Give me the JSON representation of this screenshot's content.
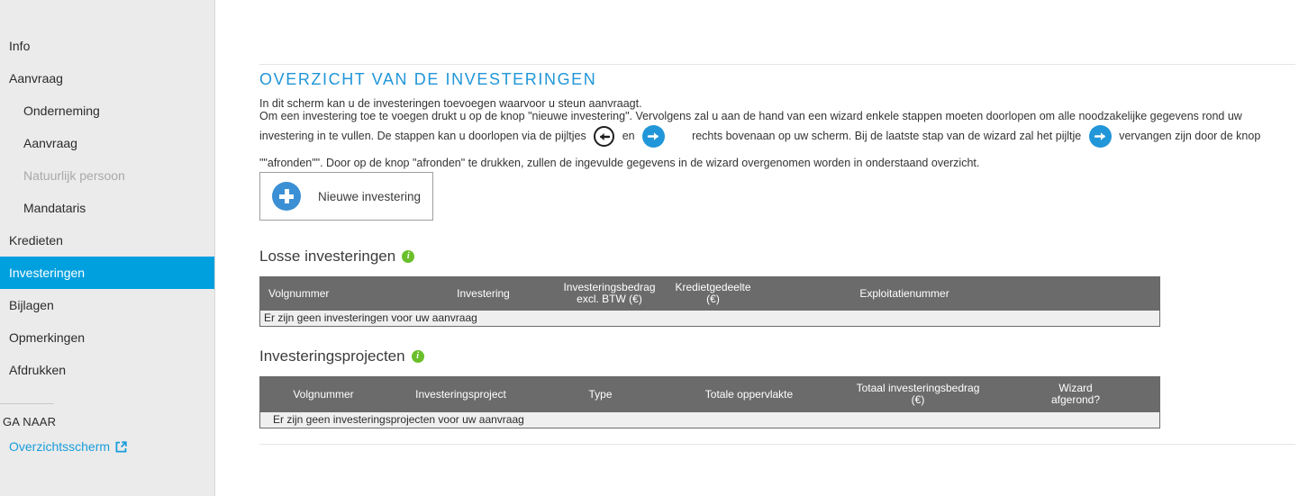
{
  "sidebar": {
    "items": [
      {
        "label": "Info",
        "level": 1,
        "state": "normal"
      },
      {
        "label": "Aanvraag",
        "level": 1,
        "state": "normal"
      },
      {
        "label": "Onderneming",
        "level": 2,
        "state": "normal"
      },
      {
        "label": "Aanvraag",
        "level": 2,
        "state": "normal"
      },
      {
        "label": "Natuurlijk persoon",
        "level": 2,
        "state": "disabled"
      },
      {
        "label": "Mandataris",
        "level": 2,
        "state": "normal"
      },
      {
        "label": "Kredieten",
        "level": 1,
        "state": "normal"
      },
      {
        "label": "Investeringen",
        "level": 1,
        "state": "active"
      },
      {
        "label": "Bijlagen",
        "level": 1,
        "state": "normal"
      },
      {
        "label": "Opmerkingen",
        "level": 1,
        "state": "normal"
      },
      {
        "label": "Afdrukken",
        "level": 1,
        "state": "normal"
      }
    ],
    "goto_label": "GA NAAR",
    "goto_link": "Overzichtsscherm",
    "active_color": "#00a0df",
    "link_color": "#1a9ddb"
  },
  "top_actions": {
    "save": "save-icon",
    "undo": "undo-icon"
  },
  "page": {
    "title": "OVERZICHT VAN DE INVESTERINGEN",
    "title_color": "#2196d8",
    "intro_line1": "In dit scherm kan u de investeringen toevoegen waarvoor u steun aanvraagt.",
    "intro_line2": "Om een investering toe te voegen drukt u op de knop \"nieuwe investering\". Vervolgens zal u aan de hand van een wizard enkele stappen moeten doorlopen om alle noodzakelijke gegevens rond uw",
    "intro_line3a": "investering in te vullen. De stappen kan u doorlopen via de pijltjes",
    "intro_line3b": "en",
    "intro_line3c": "rechts bovenaan op uw scherm. Bij de laatste stap van de wizard zal het pijltje",
    "intro_line3d": "vervangen zijn door de knop",
    "intro_line4": "\"\"afronden\"\". Door op de knop \"afronden\" te drukken, zullen de ingevulde gegevens in de wizard overgenomen worden in onderstaand overzicht."
  },
  "new_button": {
    "label": "Nieuwe investering"
  },
  "loose_investments": {
    "heading": "Losse investeringen",
    "info": "info-icon",
    "columns": [
      "Volgnummer",
      "Investering",
      "Investeringsbedrag\nexcl. BTW (€)",
      "Kredietgedeelte\n(€)",
      "Exploitatienummer"
    ],
    "columns_line1": [
      "Volgnummer",
      "Investering",
      "Investeringsbedrag",
      "Kredietgedeelte",
      "Exploitatienummer"
    ],
    "columns_line2": [
      "",
      "",
      "excl. BTW (€)",
      "(€)",
      ""
    ],
    "empty_message": "Er zijn geen investeringen voor uw aanvraag",
    "rows": []
  },
  "investment_projects": {
    "heading": "Investeringsprojecten",
    "info": "info-icon",
    "columns_line1": [
      "Volgnummer",
      "Investeringsproject",
      "Type",
      "Totale oppervlakte",
      "Totaal investeringsbedrag",
      "Wizard"
    ],
    "columns_line2": [
      "",
      "",
      "",
      "",
      "(€)",
      "afgerond?"
    ],
    "empty_message": "Er zijn geen investeringsprojecten voor uw aanvraag",
    "rows": []
  }
}
